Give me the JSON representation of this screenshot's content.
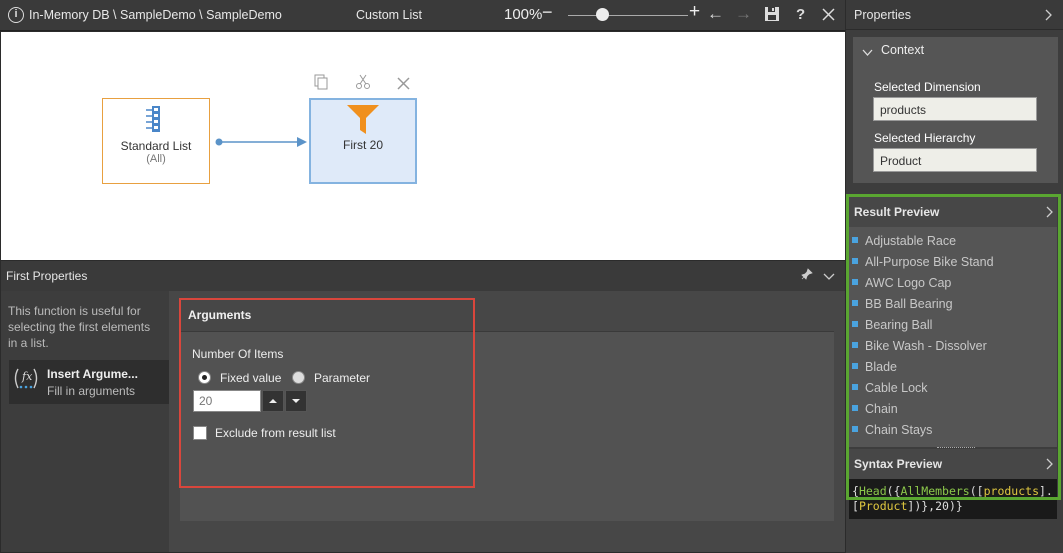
{
  "topbar": {
    "path": "In-Memory DB \\ SampleDemo \\ SampleDemo",
    "title": "Custom List",
    "zoom": "100%"
  },
  "canvas": {
    "toolbar_icons": [
      "copy-icon",
      "cut-icon",
      "close-icon"
    ],
    "nodes": [
      {
        "label": "Standard List",
        "sub": "(All)"
      },
      {
        "label": "First 20",
        "sub": ""
      }
    ]
  },
  "first_props": {
    "title": "First Properties",
    "description": "This function is useful for selecting the first elements in a list.",
    "insert": {
      "title": "Insert Argume...",
      "subtitle": "Fill in arguments"
    },
    "arguments": {
      "header": "Arguments",
      "number_label": "Number Of Items",
      "fixed_value": "Fixed value",
      "parameter": "Parameter",
      "value": "20",
      "exclude_label": "Exclude from result list"
    }
  },
  "properties": {
    "title": "Properties",
    "context": {
      "title": "Context",
      "dimension_label": "Selected Dimension",
      "dimension_value": "products",
      "hierarchy_label": "Selected Hierarchy",
      "hierarchy_value": "Product"
    },
    "result_preview": {
      "title": "Result Preview",
      "items": [
        "Adjustable Race",
        "All-Purpose Bike Stand",
        "AWC Logo Cap",
        "BB Ball Bearing",
        "Bearing Ball",
        "Bike Wash - Dissolver",
        "Blade",
        "Cable Lock",
        "Chain",
        "Chain Stays"
      ]
    },
    "syntax_preview": {
      "title": "Syntax Preview",
      "code": "{Head({AllMembers([products].[Product])},20)}"
    }
  },
  "colors": {
    "accent_blue": "#84b3e0",
    "funnel_orange": "#f0901e",
    "red_highlight": "#d9463c",
    "green_highlight": "#5aa631"
  }
}
